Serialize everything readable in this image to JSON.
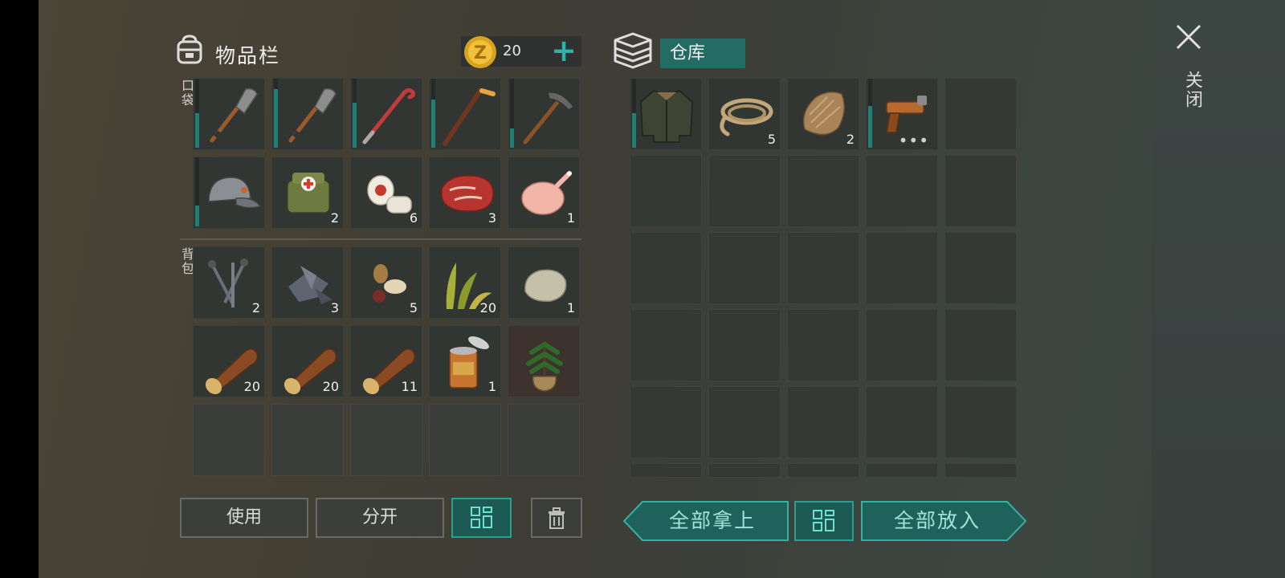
{
  "inventory": {
    "title": "物品栏",
    "coins": "20",
    "plus": "+",
    "pocket_label": "口袋",
    "backpack_label": "背包",
    "pocket_items": [
      {
        "icon": "shovel-icon",
        "qty": "",
        "durability": 0.5
      },
      {
        "icon": "shovel-icon",
        "qty": "",
        "durability": 0.85
      },
      {
        "icon": "crowbar-icon",
        "qty": "",
        "durability": 0.65
      },
      {
        "icon": "hockey-stick-icon",
        "qty": "",
        "durability": 0.7
      },
      {
        "icon": "pickaxe-icon",
        "qty": "",
        "durability": 0.28
      },
      {
        "icon": "cap-icon",
        "qty": "",
        "durability": 0.3
      },
      {
        "icon": "medkit-bag-icon",
        "qty": "2"
      },
      {
        "icon": "bandage-icon",
        "qty": "6"
      },
      {
        "icon": "steak-icon",
        "qty": "3"
      },
      {
        "icon": "raw-chicken-icon",
        "qty": "1"
      }
    ],
    "backpack_items": [
      {
        "icon": "nails-icon",
        "qty": "2"
      },
      {
        "icon": "scrap-metal-icon",
        "qty": "3"
      },
      {
        "icon": "seeds-icon",
        "qty": "5"
      },
      {
        "icon": "plant-fiber-icon",
        "qty": "20"
      },
      {
        "icon": "stone-icon",
        "qty": "1"
      },
      {
        "icon": "log-icon",
        "qty": "20"
      },
      {
        "icon": "log-icon",
        "qty": "20"
      },
      {
        "icon": "log-icon",
        "qty": "11"
      },
      {
        "icon": "canned-food-icon",
        "qty": "1"
      },
      {
        "icon": "sapling-icon",
        "qty": ""
      }
    ],
    "buttons": {
      "use": "使用",
      "split": "分开"
    }
  },
  "storage": {
    "title": "仓库",
    "items": [
      {
        "icon": "jacket-icon",
        "qty": "",
        "durability": 0.5
      },
      {
        "icon": "rope-icon",
        "qty": "5"
      },
      {
        "icon": "fur-icon",
        "qty": "2"
      },
      {
        "icon": "flare-gun-icon",
        "qty": "",
        "durability": 0.6,
        "dots": "•••"
      }
    ],
    "buttons": {
      "take_all": "全部拿上",
      "put_all": "全部放入"
    }
  },
  "close": {
    "label": "关闭"
  },
  "colors": {
    "accent": "#29b5a5",
    "teal_button": "#1d5a54",
    "durability": "#1f7f75"
  }
}
